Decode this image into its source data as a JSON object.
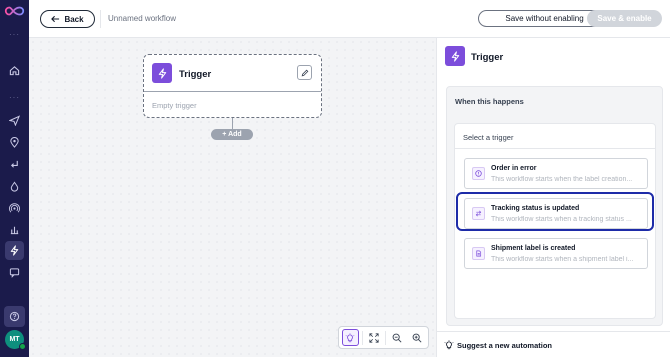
{
  "topbar": {
    "back_label": "Back",
    "workflow_name": "Unnamed workflow",
    "save_without_enabling": "Save without enabling",
    "save_enable": "Save & enable"
  },
  "canvas": {
    "node_title": "Trigger",
    "node_body": "Empty trigger",
    "add_label": "+ Add"
  },
  "panel": {
    "title": "Trigger",
    "section_label": "When this happens",
    "select_label": "Select a trigger",
    "options": [
      {
        "title": "Order in error",
        "desc": "This workflow starts when the label creation...",
        "icon": "info-circle-icon"
      },
      {
        "title": "Tracking status is updated",
        "desc": "This workflow starts when a tracking status ...",
        "icon": "tracking-update-icon"
      },
      {
        "title": "Shipment label is created",
        "desc": "This workflow starts when a shipment label i...",
        "icon": "document-icon"
      }
    ],
    "suggest_label": "Suggest a new automation"
  },
  "rail": {
    "avatar_initials": "MT"
  },
  "colors": {
    "rail_bg": "#1b1b4b",
    "accent_purple": "#7c4ddb",
    "focus_blue": "#1d2ba8"
  }
}
